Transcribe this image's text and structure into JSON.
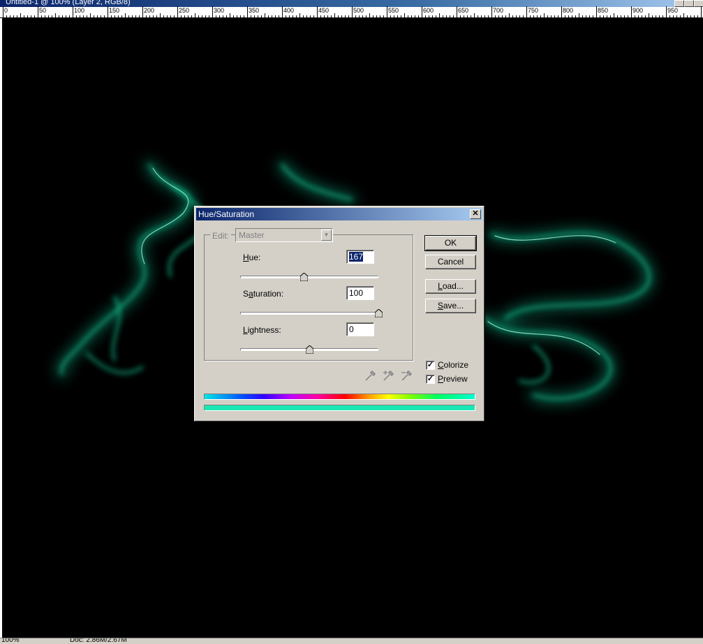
{
  "window": {
    "title": "Untitled-1 @ 100% (Layer 2, RGB/8)"
  },
  "ruler": {
    "labels": [
      "0",
      "50",
      "100",
      "150",
      "200",
      "250",
      "300",
      "350",
      "400",
      "450",
      "500",
      "550",
      "600",
      "650",
      "700",
      "750",
      "800",
      "850",
      "900",
      "950"
    ]
  },
  "statusbar": {
    "zoom": "100%",
    "doc": "Doc: 2.86M/2.67M"
  },
  "dialog": {
    "title": "Hue/Saturation",
    "close_glyph": "✕",
    "edit_label": "Edit:",
    "edit_value": "Master",
    "hue": {
      "label_pre": "",
      "label_u": "H",
      "label_post": "ue:",
      "value": "167",
      "fraction": 0.46
    },
    "saturation": {
      "label_pre": "S",
      "label_u": "a",
      "label_post": "turation:",
      "value": "100",
      "fraction": 1.0
    },
    "lightness": {
      "label_pre": "",
      "label_u": "L",
      "label_post": "ightness:",
      "value": "0",
      "fraction": 0.5
    },
    "buttons": {
      "ok": "OK",
      "cancel": "Cancel",
      "load_u": "L",
      "load_rest": "oad...",
      "save_u": "S",
      "save_rest": "ave..."
    },
    "colorize": {
      "label_u": "C",
      "label_rest": "olorize",
      "checked": true
    },
    "preview": {
      "label_u": "P",
      "label_rest": "review",
      "checked": true
    },
    "colors": {
      "result_bar": "#19e8b4"
    }
  }
}
